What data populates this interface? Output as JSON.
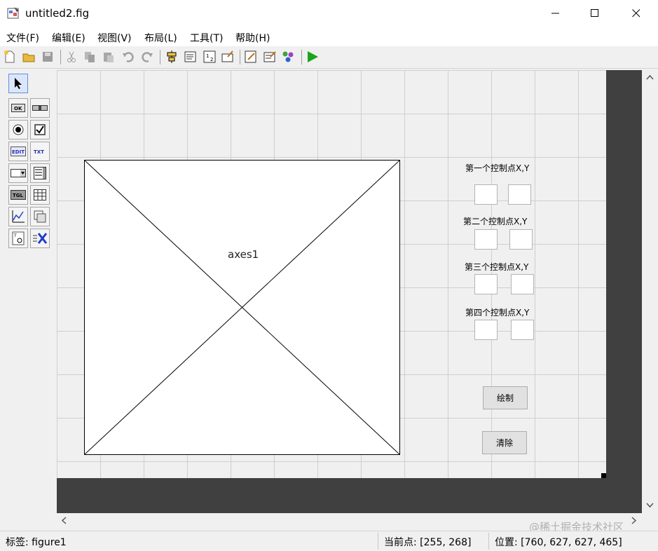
{
  "window": {
    "title": "untitled2.fig",
    "minimize_glyph": "—",
    "maximize_glyph": "☐",
    "close_glyph": "✕"
  },
  "menu": [
    {
      "label": "文件(F)"
    },
    {
      "label": "编辑(E)"
    },
    {
      "label": "视图(V)"
    },
    {
      "label": "布局(L)"
    },
    {
      "label": "工具(T)"
    },
    {
      "label": "帮助(H)"
    }
  ],
  "toolbar": {
    "icons": [
      "new-file-icon",
      "open-folder-icon",
      "save-icon",
      "cut-icon",
      "copy-icon",
      "paste-icon",
      "undo-icon",
      "redo-icon",
      "align-icon",
      "menu-editor-icon",
      "tab-order-icon",
      "toolbar-editor-icon",
      "editor-icon",
      "property-inspector-icon",
      "object-browser-icon",
      "run-icon"
    ],
    "run_color": "#1aa51a"
  },
  "palette": {
    "items": [
      {
        "name": "select-tool",
        "glyph": "➤"
      },
      {
        "name": "push-button-tool",
        "glyph": "OK"
      },
      {
        "name": "slider-tool",
        "glyph": "▭"
      },
      {
        "name": "radio-button-tool",
        "glyph": "◉"
      },
      {
        "name": "checkbox-tool",
        "glyph": "☑"
      },
      {
        "name": "edit-text-tool",
        "glyph": "EDIT"
      },
      {
        "name": "static-text-tool",
        "glyph": "TXT"
      },
      {
        "name": "popup-menu-tool",
        "glyph": "▭"
      },
      {
        "name": "listbox-tool",
        "glyph": "≣"
      },
      {
        "name": "toggle-button-tool",
        "glyph": "TGL"
      },
      {
        "name": "table-tool",
        "glyph": "▦"
      },
      {
        "name": "axes-tool",
        "glyph": "📈"
      },
      {
        "name": "panel-tool",
        "glyph": "▣"
      },
      {
        "name": "button-group-tool",
        "glyph": "▤"
      },
      {
        "name": "activex-tool",
        "glyph": "X"
      }
    ]
  },
  "figure": {
    "axes_label": "axes1",
    "labels": [
      "第一个控制点X,Y",
      "第二个控制点X,Y",
      "第三个控制点X,Y",
      "第四个控制点X,Y"
    ],
    "buttons": {
      "draw": "绘制",
      "clear": "清除"
    }
  },
  "status": {
    "tag": "标签: figure1",
    "current_point": "当前点:  [255, 268]",
    "position": "位置: [760, 627, 627, 465]"
  },
  "watermark": "@稀土掘金技术社区"
}
